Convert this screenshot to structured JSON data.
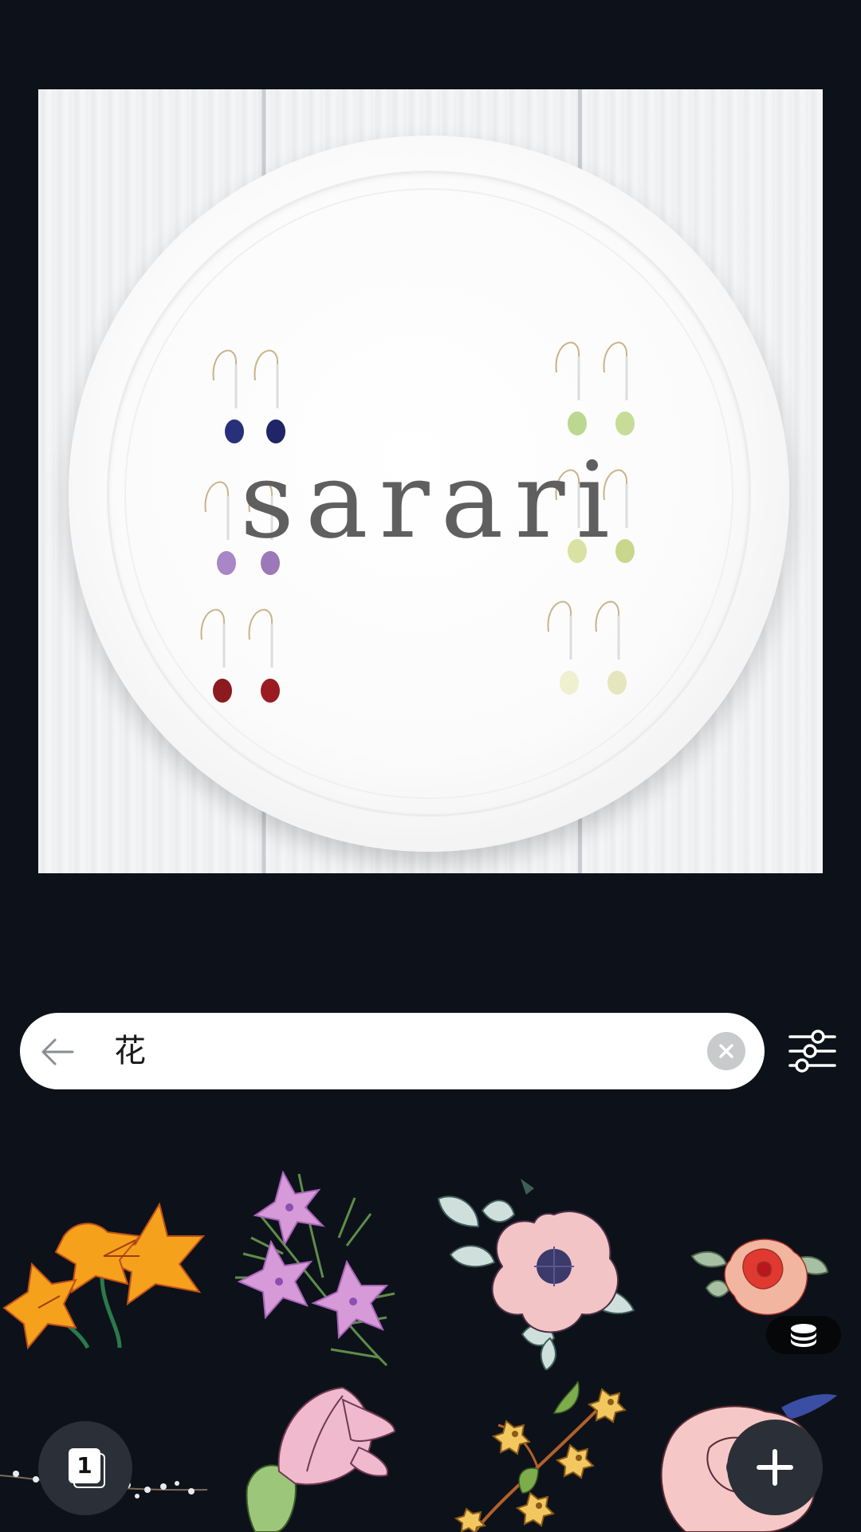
{
  "canvas": {
    "overlay_text": "sarari"
  },
  "search": {
    "value": "花",
    "back_label": "back",
    "clear_label": "clear",
    "filter_label": "filters"
  },
  "results": [
    {
      "name": "orange-lily-sticker"
    },
    {
      "name": "pink-star-flower-sticker"
    },
    {
      "name": "pink-anemone-sticker"
    },
    {
      "name": "red-peony-sticker"
    },
    {
      "name": "white-flower-branch-sticker"
    },
    {
      "name": "pink-tulip-bud-sticker"
    },
    {
      "name": "yellow-blossom-branch-sticker"
    },
    {
      "name": "pink-rose-sticker"
    }
  ],
  "badge_icon": "stack-coins-icon",
  "pages": {
    "count": "1"
  },
  "add_button_icon": "plus-icon",
  "colors": {
    "background": "#0d121a",
    "search_bg": "#ffffff",
    "button_bg": "#2b3038"
  }
}
